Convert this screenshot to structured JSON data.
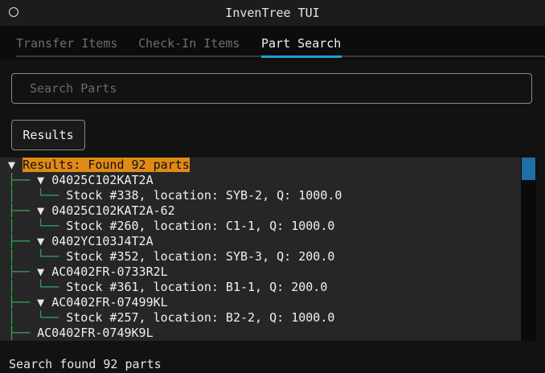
{
  "app": {
    "title": "InvenTree TUI"
  },
  "tabs": [
    {
      "label": "Transfer Items",
      "active": false
    },
    {
      "label": "Check-In Items",
      "active": false
    },
    {
      "label": "Part Search",
      "active": true
    }
  ],
  "search": {
    "placeholder": "Search Parts",
    "value": ""
  },
  "results_button": {
    "label": "Results"
  },
  "tree": {
    "root": {
      "expander": "▼",
      "label": "Results: Found 92 parts"
    },
    "parts": [
      {
        "expander": "▼",
        "name": "04025C102KAT2A",
        "stock": "Stock #338, location: SYB-2, Q: 1000.0"
      },
      {
        "expander": "▼",
        "name": "04025C102KAT2A-62",
        "stock": "Stock #260, location: C1-1, Q: 1000.0"
      },
      {
        "expander": "▼",
        "name": "0402YC103J4T2A",
        "stock": "Stock #352, location: SYB-3, Q: 200.0"
      },
      {
        "expander": "▼",
        "name": "AC0402FR-0733R2L",
        "stock": "Stock #361, location: B1-1, Q: 200.0"
      },
      {
        "expander": "▼",
        "name": "AC0402FR-07499KL",
        "stock": "Stock #257, location: B2-2, Q: 1000.0"
      },
      {
        "expander": "",
        "name": "AC0402FR-0749K9L",
        "stock": ""
      }
    ]
  },
  "status": {
    "text": "Search found 92 parts"
  },
  "colors": {
    "accent": "#1ea0d8",
    "root_highlight": "#e08a17",
    "tree_guide": "#2ea85a",
    "scroll_thumb": "#1e6fa8"
  }
}
